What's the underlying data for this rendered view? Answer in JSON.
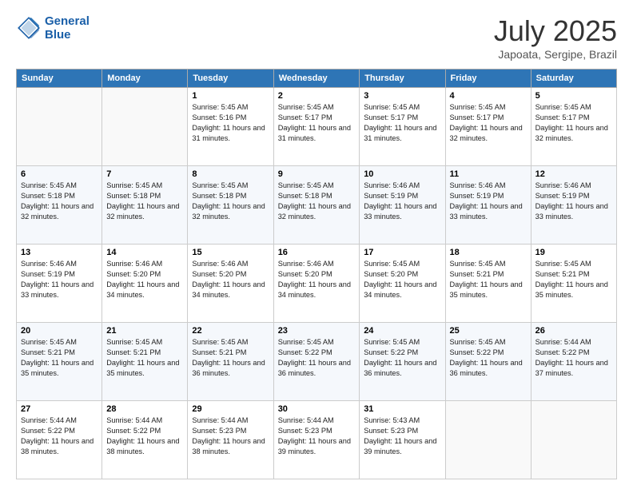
{
  "header": {
    "logo_line1": "General",
    "logo_line2": "Blue",
    "month": "July 2025",
    "location": "Japoata, Sergipe, Brazil"
  },
  "weekdays": [
    "Sunday",
    "Monday",
    "Tuesday",
    "Wednesday",
    "Thursday",
    "Friday",
    "Saturday"
  ],
  "weeks": [
    [
      {
        "day": "",
        "info": ""
      },
      {
        "day": "",
        "info": ""
      },
      {
        "day": "1",
        "info": "Sunrise: 5:45 AM\nSunset: 5:16 PM\nDaylight: 11 hours and 31 minutes."
      },
      {
        "day": "2",
        "info": "Sunrise: 5:45 AM\nSunset: 5:17 PM\nDaylight: 11 hours and 31 minutes."
      },
      {
        "day": "3",
        "info": "Sunrise: 5:45 AM\nSunset: 5:17 PM\nDaylight: 11 hours and 31 minutes."
      },
      {
        "day": "4",
        "info": "Sunrise: 5:45 AM\nSunset: 5:17 PM\nDaylight: 11 hours and 32 minutes."
      },
      {
        "day": "5",
        "info": "Sunrise: 5:45 AM\nSunset: 5:17 PM\nDaylight: 11 hours and 32 minutes."
      }
    ],
    [
      {
        "day": "6",
        "info": "Sunrise: 5:45 AM\nSunset: 5:18 PM\nDaylight: 11 hours and 32 minutes."
      },
      {
        "day": "7",
        "info": "Sunrise: 5:45 AM\nSunset: 5:18 PM\nDaylight: 11 hours and 32 minutes."
      },
      {
        "day": "8",
        "info": "Sunrise: 5:45 AM\nSunset: 5:18 PM\nDaylight: 11 hours and 32 minutes."
      },
      {
        "day": "9",
        "info": "Sunrise: 5:45 AM\nSunset: 5:18 PM\nDaylight: 11 hours and 32 minutes."
      },
      {
        "day": "10",
        "info": "Sunrise: 5:46 AM\nSunset: 5:19 PM\nDaylight: 11 hours and 33 minutes."
      },
      {
        "day": "11",
        "info": "Sunrise: 5:46 AM\nSunset: 5:19 PM\nDaylight: 11 hours and 33 minutes."
      },
      {
        "day": "12",
        "info": "Sunrise: 5:46 AM\nSunset: 5:19 PM\nDaylight: 11 hours and 33 minutes."
      }
    ],
    [
      {
        "day": "13",
        "info": "Sunrise: 5:46 AM\nSunset: 5:19 PM\nDaylight: 11 hours and 33 minutes."
      },
      {
        "day": "14",
        "info": "Sunrise: 5:46 AM\nSunset: 5:20 PM\nDaylight: 11 hours and 34 minutes."
      },
      {
        "day": "15",
        "info": "Sunrise: 5:46 AM\nSunset: 5:20 PM\nDaylight: 11 hours and 34 minutes."
      },
      {
        "day": "16",
        "info": "Sunrise: 5:46 AM\nSunset: 5:20 PM\nDaylight: 11 hours and 34 minutes."
      },
      {
        "day": "17",
        "info": "Sunrise: 5:45 AM\nSunset: 5:20 PM\nDaylight: 11 hours and 34 minutes."
      },
      {
        "day": "18",
        "info": "Sunrise: 5:45 AM\nSunset: 5:21 PM\nDaylight: 11 hours and 35 minutes."
      },
      {
        "day": "19",
        "info": "Sunrise: 5:45 AM\nSunset: 5:21 PM\nDaylight: 11 hours and 35 minutes."
      }
    ],
    [
      {
        "day": "20",
        "info": "Sunrise: 5:45 AM\nSunset: 5:21 PM\nDaylight: 11 hours and 35 minutes."
      },
      {
        "day": "21",
        "info": "Sunrise: 5:45 AM\nSunset: 5:21 PM\nDaylight: 11 hours and 35 minutes."
      },
      {
        "day": "22",
        "info": "Sunrise: 5:45 AM\nSunset: 5:21 PM\nDaylight: 11 hours and 36 minutes."
      },
      {
        "day": "23",
        "info": "Sunrise: 5:45 AM\nSunset: 5:22 PM\nDaylight: 11 hours and 36 minutes."
      },
      {
        "day": "24",
        "info": "Sunrise: 5:45 AM\nSunset: 5:22 PM\nDaylight: 11 hours and 36 minutes."
      },
      {
        "day": "25",
        "info": "Sunrise: 5:45 AM\nSunset: 5:22 PM\nDaylight: 11 hours and 36 minutes."
      },
      {
        "day": "26",
        "info": "Sunrise: 5:44 AM\nSunset: 5:22 PM\nDaylight: 11 hours and 37 minutes."
      }
    ],
    [
      {
        "day": "27",
        "info": "Sunrise: 5:44 AM\nSunset: 5:22 PM\nDaylight: 11 hours and 38 minutes."
      },
      {
        "day": "28",
        "info": "Sunrise: 5:44 AM\nSunset: 5:22 PM\nDaylight: 11 hours and 38 minutes."
      },
      {
        "day": "29",
        "info": "Sunrise: 5:44 AM\nSunset: 5:23 PM\nDaylight: 11 hours and 38 minutes."
      },
      {
        "day": "30",
        "info": "Sunrise: 5:44 AM\nSunset: 5:23 PM\nDaylight: 11 hours and 39 minutes."
      },
      {
        "day": "31",
        "info": "Sunrise: 5:43 AM\nSunset: 5:23 PM\nDaylight: 11 hours and 39 minutes."
      },
      {
        "day": "",
        "info": ""
      },
      {
        "day": "",
        "info": ""
      }
    ]
  ]
}
